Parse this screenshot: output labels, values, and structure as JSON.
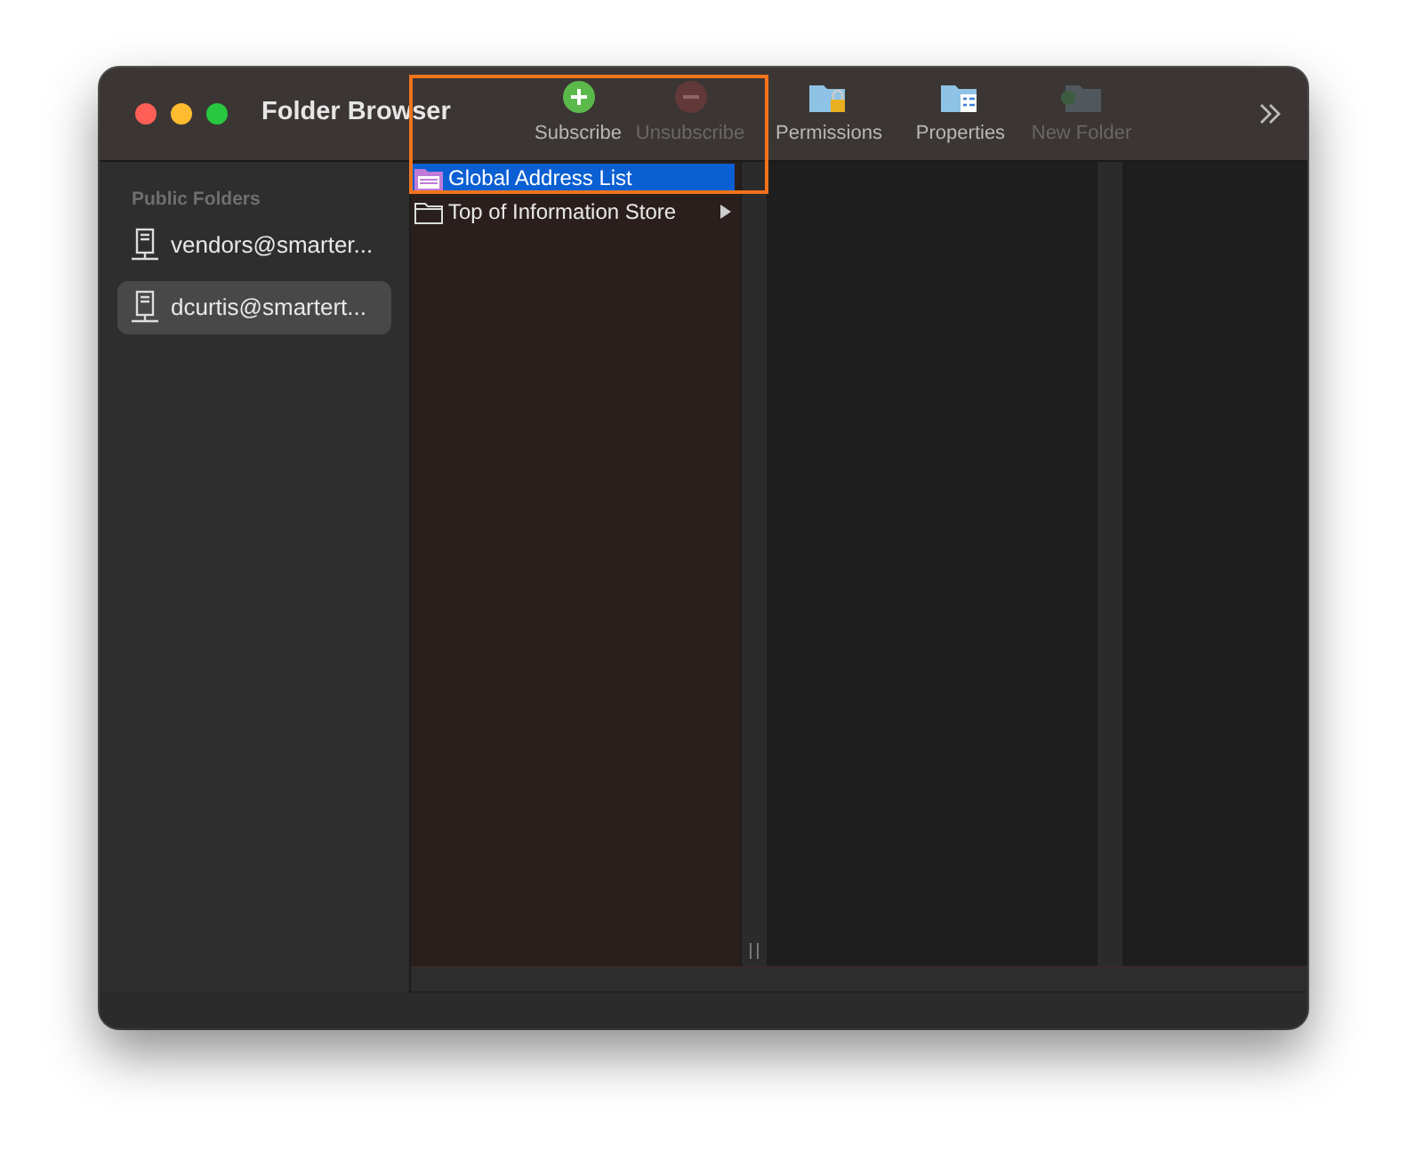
{
  "window": {
    "title": "Folder Browser"
  },
  "toolbar": [
    {
      "label": "Subscribe",
      "kind": "add",
      "disabled": false
    },
    {
      "label": "Unsubscribe",
      "kind": "remove",
      "disabled": true
    },
    {
      "label": "Permissions",
      "kind": "permissions",
      "disabled": false
    },
    {
      "label": "Properties",
      "kind": "properties",
      "disabled": false
    },
    {
      "label": "New Folder",
      "kind": "new-folder",
      "disabled": true
    }
  ],
  "sidebar": {
    "section": "Public Folders",
    "items": [
      {
        "label": "vendors@smarter...",
        "selected": false
      },
      {
        "label": "dcurtis@smartert...",
        "selected": true
      }
    ]
  },
  "browser": {
    "column_1": [
      {
        "label": "Global Address List",
        "kind": "address-list",
        "selected": true,
        "expandable": false
      },
      {
        "label": "Top of Information Store",
        "kind": "folder",
        "selected": false,
        "expandable": true
      }
    ]
  }
}
